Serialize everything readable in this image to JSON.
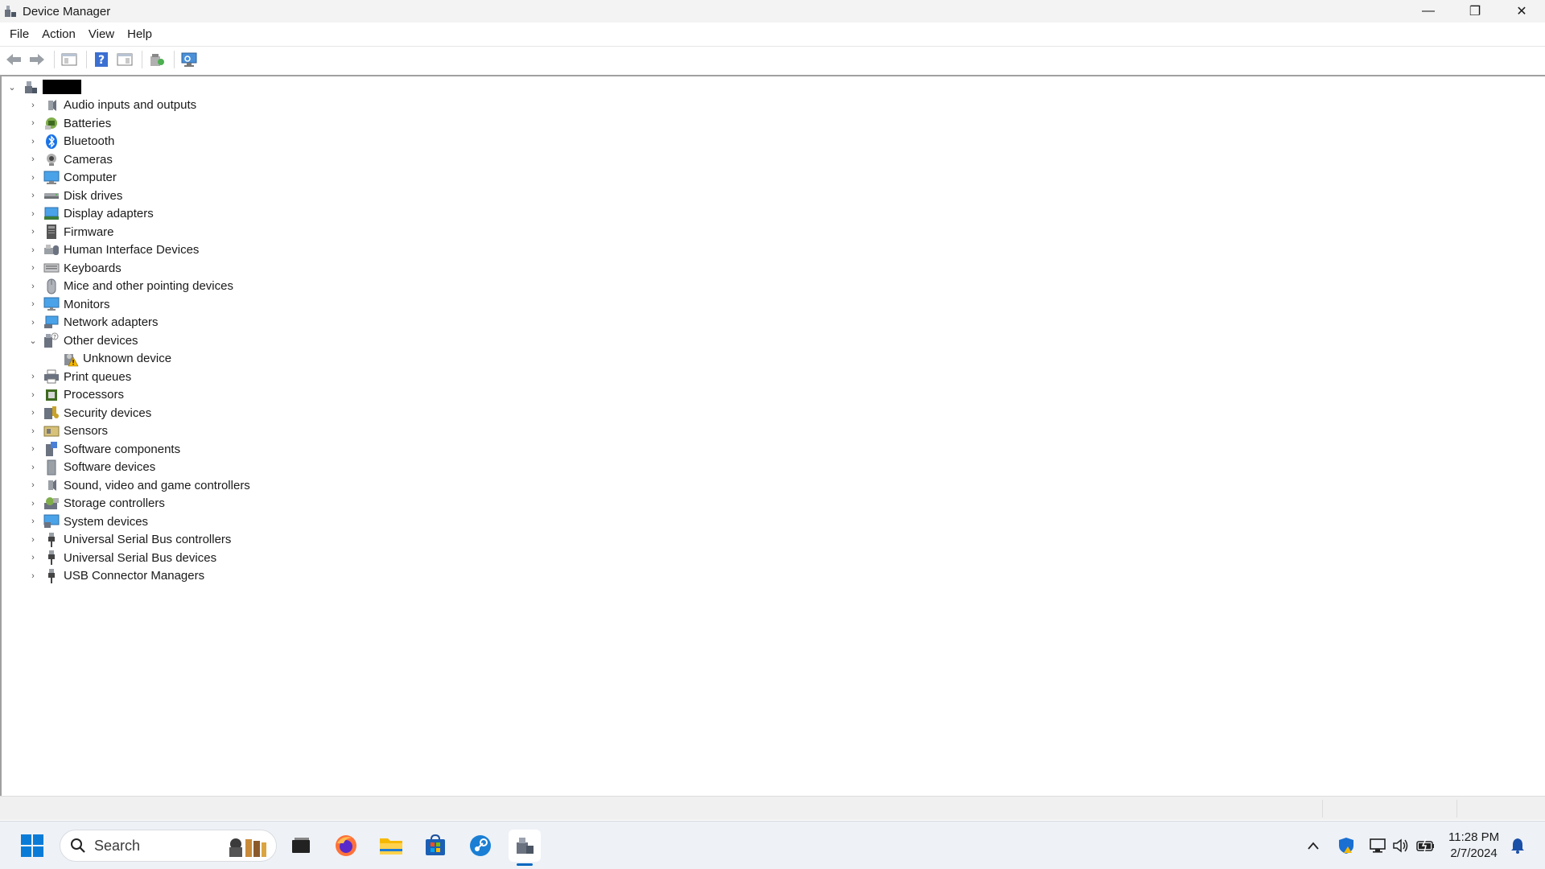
{
  "window": {
    "title": "Device Manager",
    "controls": {
      "minimize": "—",
      "maximize": "❐",
      "close": "✕"
    }
  },
  "menu": [
    "File",
    "Action",
    "View",
    "Help"
  ],
  "toolbar": {
    "buttons": [
      "back-icon",
      "forward-icon",
      "properties-pane-icon",
      "help-icon",
      "show-hide-console-tree-icon",
      "update-driver-icon",
      "scan-hardware-icon"
    ]
  },
  "tree": {
    "root_label": "",
    "items": [
      {
        "label": "Audio inputs and outputs",
        "icon": "speaker-icon",
        "expanded": false
      },
      {
        "label": "Batteries",
        "icon": "battery-icon",
        "expanded": false
      },
      {
        "label": "Bluetooth",
        "icon": "bluetooth-icon",
        "expanded": false
      },
      {
        "label": "Cameras",
        "icon": "camera-icon",
        "expanded": false
      },
      {
        "label": "Computer",
        "icon": "computer-icon",
        "expanded": false
      },
      {
        "label": "Disk drives",
        "icon": "disk-drive-icon",
        "expanded": false
      },
      {
        "label": "Display adapters",
        "icon": "display-adapter-icon",
        "expanded": false
      },
      {
        "label": "Firmware",
        "icon": "firmware-icon",
        "expanded": false
      },
      {
        "label": "Human Interface Devices",
        "icon": "hid-icon",
        "expanded": false
      },
      {
        "label": "Keyboards",
        "icon": "keyboard-icon",
        "expanded": false
      },
      {
        "label": "Mice and other pointing devices",
        "icon": "mouse-icon",
        "expanded": false
      },
      {
        "label": "Monitors",
        "icon": "monitor-icon",
        "expanded": false
      },
      {
        "label": "Network adapters",
        "icon": "network-adapter-icon",
        "expanded": false
      },
      {
        "label": "Other devices",
        "icon": "other-devices-icon",
        "expanded": true
      },
      {
        "label": "Unknown device",
        "icon": "unknown-device-warning-icon",
        "child": true
      },
      {
        "label": "Print queues",
        "icon": "printer-icon",
        "expanded": false
      },
      {
        "label": "Processors",
        "icon": "processor-icon",
        "expanded": false
      },
      {
        "label": "Security devices",
        "icon": "security-device-icon",
        "expanded": false
      },
      {
        "label": "Sensors",
        "icon": "sensor-icon",
        "expanded": false
      },
      {
        "label": "Software components",
        "icon": "software-component-icon",
        "expanded": false
      },
      {
        "label": "Software devices",
        "icon": "software-device-icon",
        "expanded": false
      },
      {
        "label": "Sound, video and game controllers",
        "icon": "speaker-icon",
        "expanded": false
      },
      {
        "label": "Storage controllers",
        "icon": "storage-controller-icon",
        "expanded": false
      },
      {
        "label": "System devices",
        "icon": "system-devices-icon",
        "expanded": false
      },
      {
        "label": "Universal Serial Bus controllers",
        "icon": "usb-icon",
        "expanded": false
      },
      {
        "label": "Universal Serial Bus devices",
        "icon": "usb-icon",
        "expanded": false
      },
      {
        "label": "USB Connector Managers",
        "icon": "usb-icon",
        "expanded": false
      }
    ]
  },
  "taskbar": {
    "search_placeholder": "Search",
    "apps": [
      "start-icon",
      "task-view-icon",
      "firefox-icon",
      "file-explorer-icon",
      "store-icon",
      "steam-icon",
      "device-manager-icon"
    ],
    "tray": [
      "show-hidden-icons-chevron",
      "security-shield-icon",
      "network-icon",
      "volume-icon",
      "battery-icon"
    ],
    "time": "11:28 PM",
    "date": "2/7/2024"
  },
  "colors": {
    "accent": "#0067c0",
    "tree_border": "#a0a0a0"
  }
}
